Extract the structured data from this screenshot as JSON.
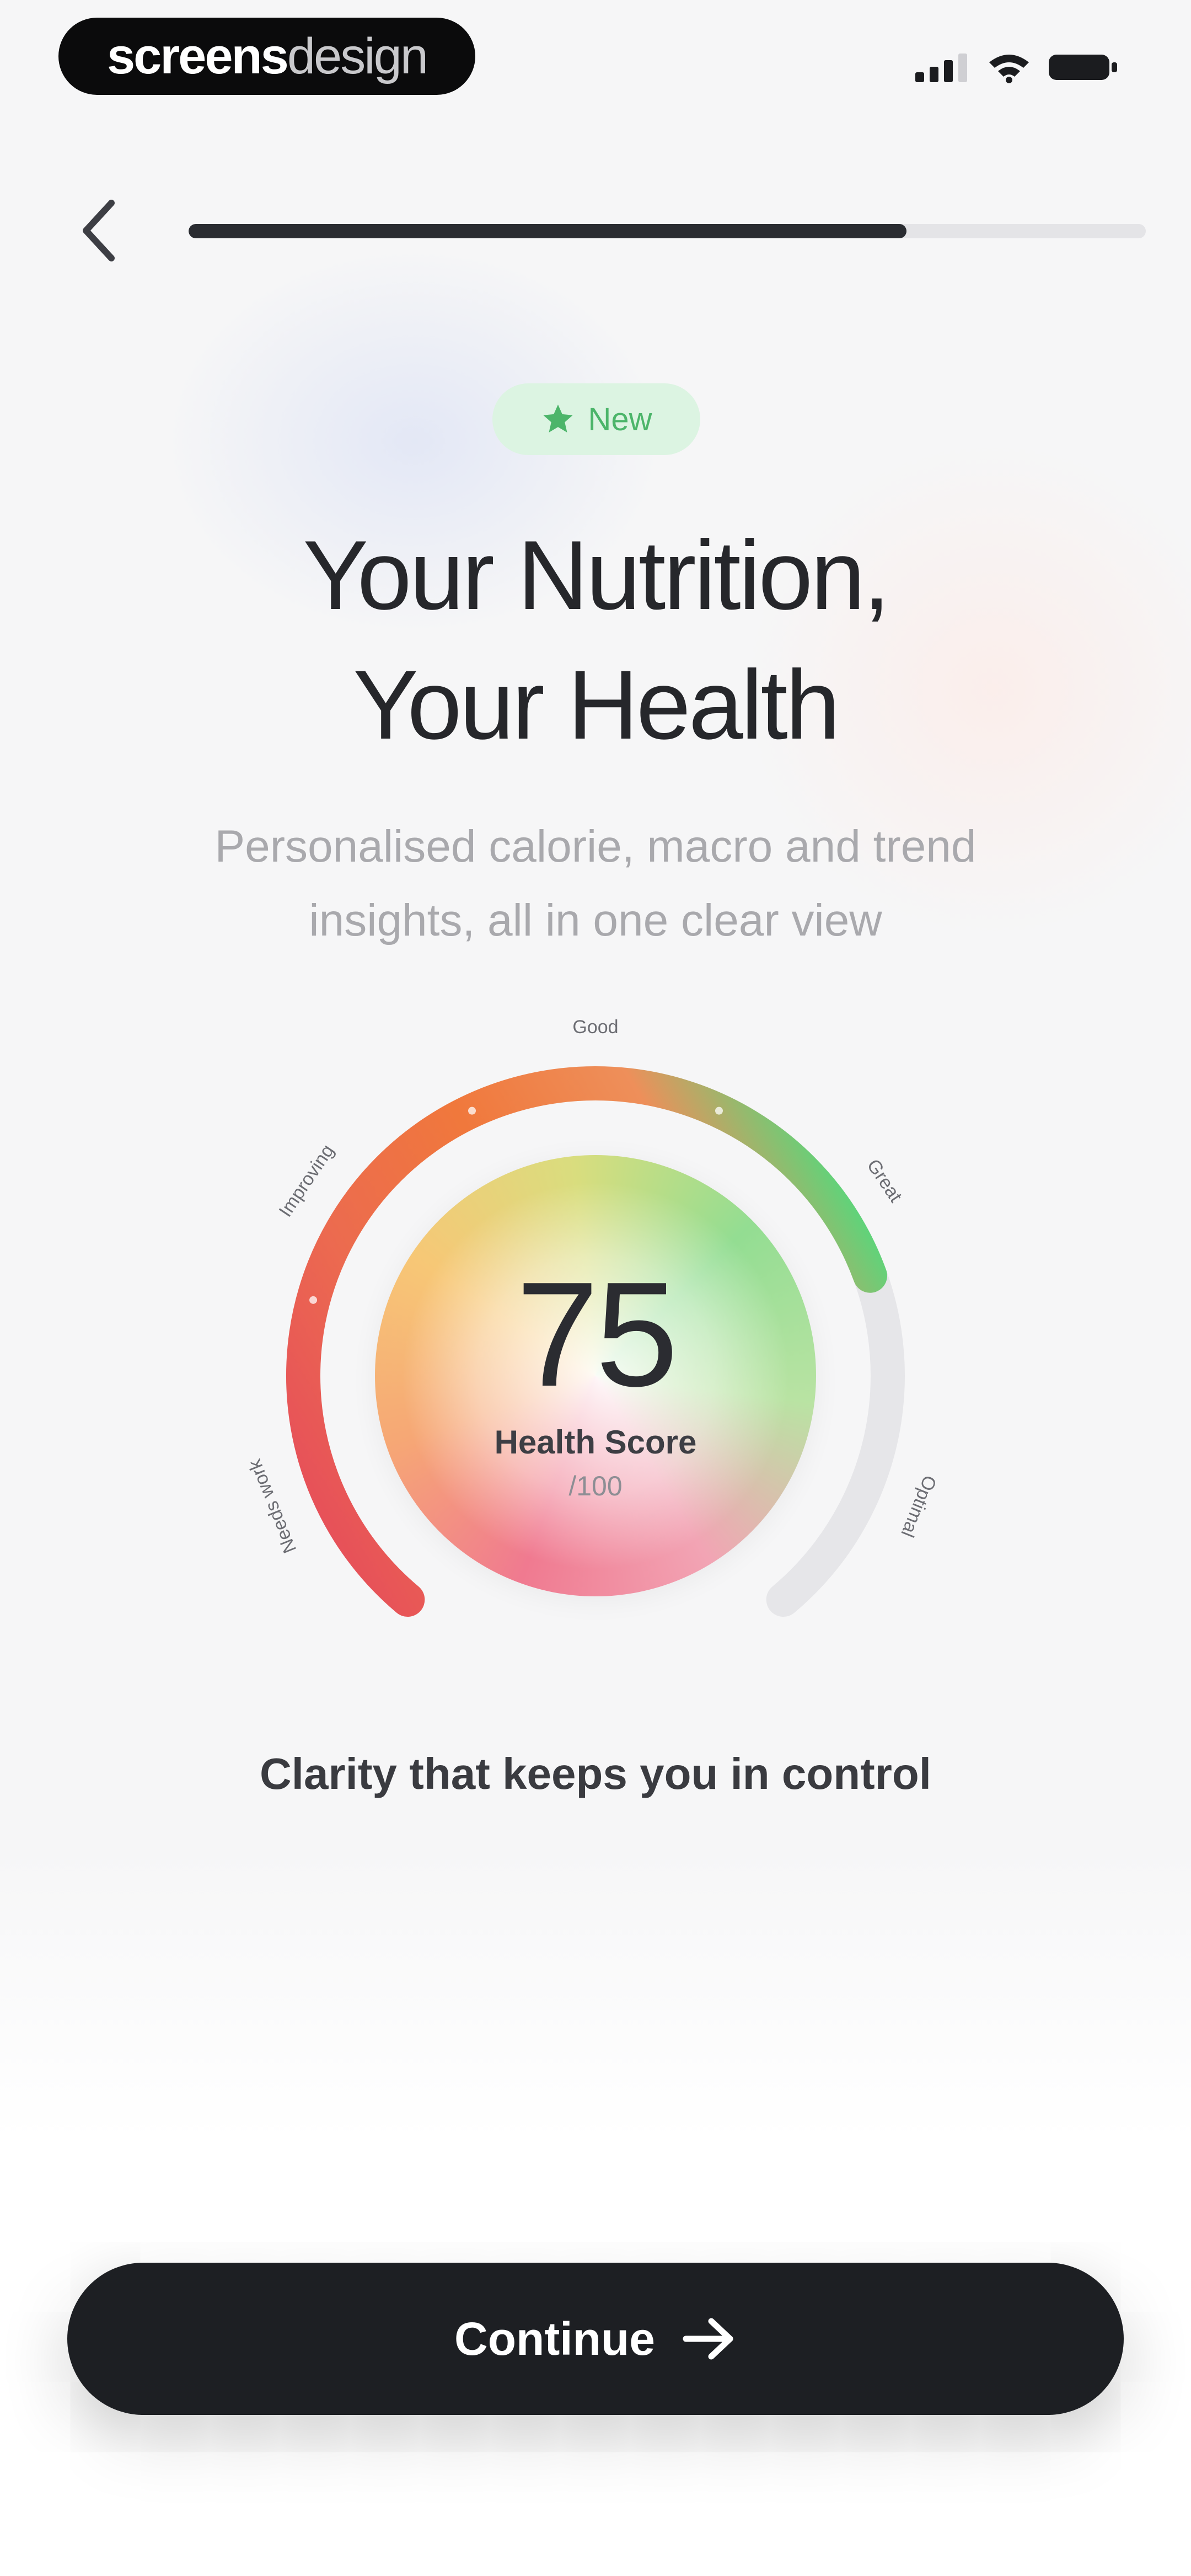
{
  "brand": {
    "part1": "screens",
    "part2": "design"
  },
  "status_bar": {
    "icons": [
      "cellular-signal-icon",
      "wifi-icon",
      "battery-icon"
    ]
  },
  "navigation": {
    "back_icon": "chevron-left-icon"
  },
  "progress": {
    "value_percent": 75
  },
  "badge": {
    "icon": "star-icon",
    "label": "New"
  },
  "headline": {
    "line1": "Your Nutrition,",
    "line2": "Your Health"
  },
  "subtitle": {
    "line1": "Personalised calorie, macro and trend",
    "line2": "insights, all in one clear view"
  },
  "gauge": {
    "score": "75",
    "label": "Health Score",
    "max_label": "/100",
    "fill_percent": 75,
    "segment_labels": [
      "Needs work",
      "Improving",
      "Good",
      "Great",
      "Optimal"
    ],
    "colors": {
      "low": "#e5495c",
      "mid": "#f0783c",
      "high": "#ee8f5a",
      "good": "#5ed47a",
      "track": "#e6e6e9"
    }
  },
  "tagline": "Clarity that keeps you in control",
  "cta": {
    "label": "Continue",
    "icon": "arrow-right-icon"
  },
  "colors": {
    "accent_green": "#4cb56a",
    "dark": "#1d1f23",
    "background": "#f6f6f7"
  }
}
